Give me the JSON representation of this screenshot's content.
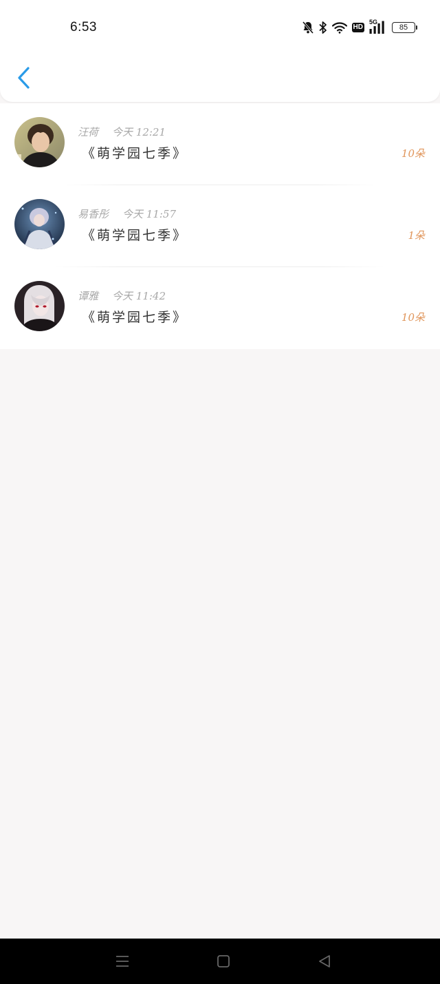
{
  "status_bar": {
    "time": "6:53",
    "hd_label": "HD",
    "network_label": "5G",
    "battery": "85",
    "icons": [
      "mute-bell-icon",
      "bluetooth-icon",
      "wifi-icon",
      "hd-icon",
      "signal-5g-icon",
      "battery-icon"
    ]
  },
  "header": {
    "back_icon": "chevron-left-icon",
    "accent_color": "#2a9be8"
  },
  "items": [
    {
      "name": "汪荷",
      "time": "今天 12:21",
      "title": "《萌学园七季》",
      "count": "10朵"
    },
    {
      "name": "易香彤",
      "time": "今天 11:57",
      "title": "《萌学园七季》",
      "count": "1朵"
    },
    {
      "name": "谭雅",
      "time": "今天 11:42",
      "title": "《萌学园七季》",
      "count": "10朵"
    }
  ],
  "nav_bar": {
    "buttons": [
      "menu-icon",
      "home-square-icon",
      "back-triangle-icon"
    ]
  },
  "colors": {
    "count": "#e0955a",
    "meta": "#a8a8a8",
    "background": "#f8f6f6"
  }
}
